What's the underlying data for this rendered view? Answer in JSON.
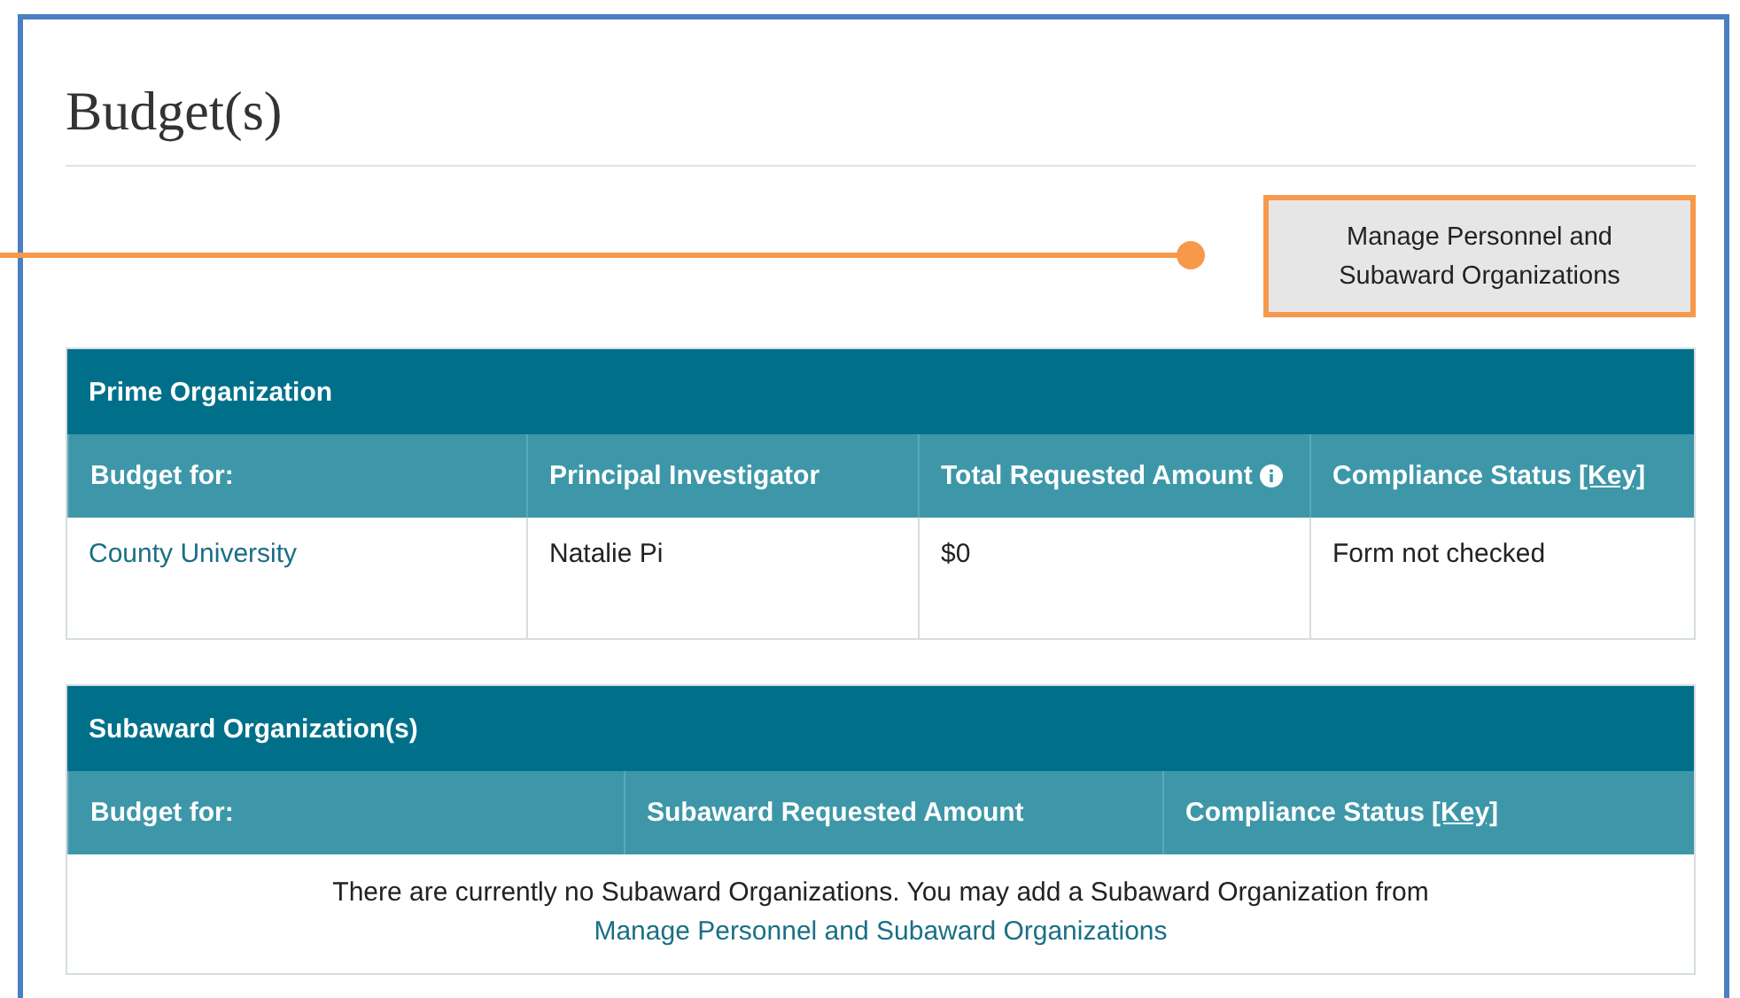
{
  "title": "Budget(s)",
  "manage_button": {
    "label": "Manage Personnel and Subaward Organizations"
  },
  "prime": {
    "heading": "Prime Organization",
    "columns": [
      {
        "label": "Budget for:"
      },
      {
        "label": "Principal Investigator"
      },
      {
        "label": "Total Requested Amount",
        "info": true
      },
      {
        "label": "Compliance Status",
        "key_link": "[Key]"
      }
    ],
    "rows": [
      {
        "cells": [
          {
            "text": "County University",
            "kind": "link"
          },
          {
            "text": "Natalie Pi",
            "kind": "text"
          },
          {
            "text": "$0",
            "kind": "text"
          },
          {
            "text": "Form not checked",
            "kind": "text"
          }
        ]
      }
    ]
  },
  "subaward": {
    "heading": "Subaward Organization(s)",
    "columns": [
      {
        "label": "Budget for:"
      },
      {
        "label": "Subaward Requested Amount"
      },
      {
        "label": "Compliance Status",
        "key_link": "[Key]"
      }
    ],
    "empty_message": "There are currently no Subaward Organizations. You may add a Subaward Organization from",
    "empty_link": "Manage Personnel and Subaward Organizations"
  }
}
